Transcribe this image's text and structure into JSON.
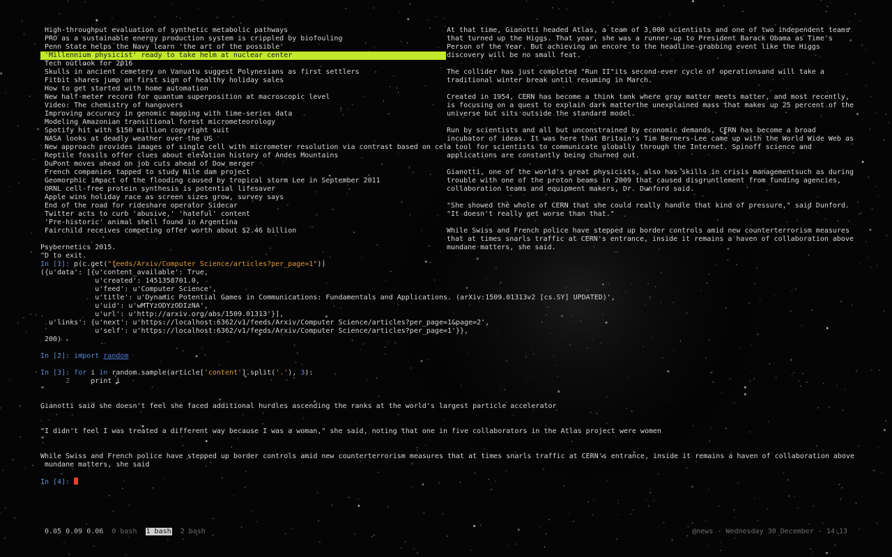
{
  "headlines": {
    "items": [
      "High-throughput evaluation of synthetic metabolic pathways",
      "PRO as a sustainable energy production system is crippled by biofouling",
      "Penn State helps the Navy learn 'the art of the possible'",
      "'Millennium physicist' ready to take helm at nuclear center",
      "Tech outlook for 2016",
      "Skulls in ancient cemetery on Vanuatu suggest Polynesians as first settlers",
      "Fitbit shares jump on first sign of healthy holiday sales",
      "How to get started with home automation",
      "New half-meter record for quantum superposition at macroscopic level",
      "Video: The chemistry of hangovers",
      "Improving accuracy in genomic mapping with time-series data",
      "Modeling Amazonian transitional forest micrometeorology",
      "Spotify hit with $150 million copyright suit",
      "NASA looks at deadly weather over the US",
      "New approach provides images of single cell with micrometer resolution via contrast based on cell",
      "Reptile fossils offer clues about elevation history of Andes Mountains",
      "DuPont moves ahead on job cuts ahead of Dow merger",
      "French companies tapped to study Nile dam project",
      "Geomorphic impact of the flooding caused by tropical storm Lee in September 2011",
      "ORNL cell-free protein synthesis is potential lifesaver",
      "Apple wins holiday race as screen sizes grow, survey says",
      "End of the road for rideshare operator Sidecar",
      "Twitter acts to curb 'abusive,' 'hateful' content",
      "'Pre-historic' animal shell found in Argentina",
      "Fairchild receives competing offer worth about $2.46 billion"
    ]
  },
  "article": {
    "lines": [
      "At that time, Gianotti headed Atlas, a team of 3,000 scientists and one of two independent teams",
      "that turned up the Higgs. That year, she was a runner-up to President Barack Obama as Time's",
      "Person of the Year. But achieving an encore to the headline-grabbing event like the Higgs",
      "discovery will be no small feat.",
      "",
      "The collider has just completed \"Run II\"its second-ever cycle of operationsand will take a",
      "traditional winter break until resuming in March.",
      "",
      "Created in 1954, CERN has become a think tank where gray matter meets matter, and most recently,",
      "is focusing on a quest to explain dark matterthe unexplained mass that makes up 25 percent of the",
      "universe but sits outside the standard model.",
      "",
      "Run by scientists and all but unconstrained by economic demands, CERN has become a broad",
      "incubator of ideas. It was here that Britain's Tim Berners-Lee came up with the World Wide Web as",
      "a tool for scientists to communicate globally through the Internet. Spinoff science and",
      "applications are constantly being churned out.",
      "",
      "Gianotti, one of the world's great physicists, also has skills in crisis managementsuch as during",
      "trouble with one of the proton beams in 2009 that caused disgruntlement from funding agencies,",
      "collaboration teams and equipment makers, Dr. Dunford said.",
      "",
      "\"She showed the whole of CERN that she could really handle that kind of pressure,\" said Dunford.",
      "\"It doesn't really get worse than that.\"",
      "",
      "While Swiss and French police have stepped up border controls amid new counterterrorism measures",
      "that at times snarls traffic at CERN's entrance, inside it remains a haven of collaboration above",
      "mundane matters, she said."
    ]
  },
  "repl": {
    "banner1": "Psybernetics 2015.",
    "banner2": "^D to exit.",
    "in1": "In [1]: ",
    "cmd1_pre": "p(c.get(",
    "cmd1_str": "\"feeds/Arxiv/Computer Science/articles?per_page=1\"",
    "cmd1_post": "))",
    "out": [
      "({u'data': [{u'content_available': True,",
      "             u'created': 1451358701.0,",
      "             u'feed': u'Computer Science',",
      "             u'title': u'Dynamic Potential Games in Communications: Fundamentals and Applications. (arXiv:1509.01313v2 [cs.SY] UPDATED)',",
      "             u'uid': u'wMTYzODYzODIzNA',",
      "             u'url': u'http://arxiv.org/abs/1509.01313'}],",
      "  u'links': {u'next': u'https://localhost:6362/v1/feeds/Arxiv/Computer Science/articles?per_page=1&page=2',",
      "             u'self': u'https://localhost:6362/v1/feeds/Arxiv/Computer Science/articles?per_page=1'}},",
      " 200)"
    ],
    "in2": "In [2]: ",
    "cmd2_kw": "import",
    "cmd2_mod": "random",
    "in3": "In [3]: ",
    "cmd3_for": "for",
    "cmd3_i": " i ",
    "cmd3_in": "in",
    "cmd3_mid": " random.sample(article[",
    "cmd3_str": "'content'",
    "cmd3_mid2": "].split(",
    "cmd3_str2": "'.'",
    "cmd3_mid3": "), ",
    "cmd3_num": "3",
    "cmd3_end": "):",
    "cont_num": "      2",
    "cont_code": "     print i",
    "q1": "\"",
    "p1": "Gianotti said she doesn't feel she faced additional hurdles ascending the ranks at the world's largest particle accelerator",
    "p2": "\"I didn't feel I was treated a different way because I was a woman,\" she said, noting that one in five collaborators in the Atlas project were women",
    "q2": "\"",
    "p3a": "While Swiss and French police have stepped up border controls amid new counterterrorism measures that at times snarls traffic at CERN's entrance, inside it remains a haven of collaboration above",
    "p3b": " mundane matters, she said",
    "in4": "In [4]: "
  },
  "status": {
    "load": "0.05 0.09 0.06",
    "windows": [
      "0 bash",
      "1 bash",
      "2 bash"
    ],
    "active_window": 1,
    "right": "@news - Wednesday 30 December - 14:13"
  }
}
